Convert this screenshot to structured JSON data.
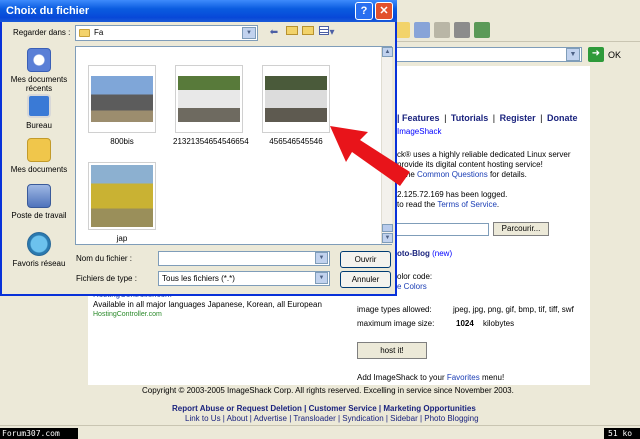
{
  "dialog": {
    "title": "Choix du fichier",
    "help_btn": "?",
    "close_btn": "✕",
    "look_in_label": "Regarder dans :",
    "look_in_value": "Fa",
    "file_name_label": "Nom du fichier :",
    "file_name_value": "",
    "file_type_label": "Fichiers de type :",
    "file_type_value": "Tous les fichiers (*.*)",
    "open_button": "Ouvrir",
    "cancel_button": "Annuler",
    "places": [
      {
        "label": "Mes documents récents",
        "icon": "recent-documents-icon",
        "color": "#5a7fd6"
      },
      {
        "label": "Bureau",
        "icon": "desktop-icon",
        "color": "#3a7ad6"
      },
      {
        "label": "Mes documents",
        "icon": "my-documents-icon",
        "color": "#f0c64b"
      },
      {
        "label": "Poste de travail",
        "icon": "my-computer-icon",
        "color": "#6b8ec8"
      },
      {
        "label": "Favoris réseau",
        "icon": "network-places-icon",
        "color": "#3aa0d6"
      }
    ],
    "files": [
      {
        "name": "800bis"
      },
      {
        "name": "21321354654546654"
      },
      {
        "name": "456546545546"
      },
      {
        "name": "jap"
      }
    ]
  },
  "page": {
    "nav": [
      "| Features",
      "Tutorials",
      "Register",
      "Donate"
    ],
    "imageshack_link": "ImageShack",
    "intro_line1": "ck® uses a highly reliable dedicated Linux server",
    "intro_line2": "provide its digital content hosting service!",
    "intro_line3_pre": "e the ",
    "intro_line3_link": "Common Questions",
    "intro_line3_post": " for details.",
    "ip_line1": "2.125.72.169 has been logged.",
    "ip_line2_pre": "to read the ",
    "ip_line2_link": "Terms of Service",
    "ip_line2_post": ".",
    "browse_button": "Parcourir...",
    "blog_title": "oto-Blog",
    "blog_new": "(new)",
    "color_code": "olor code:",
    "colors_link": "e Colors",
    "image_types_label": "image types allowed:",
    "image_types_value": "jpeg, jpg, png, gif, bmp, tif, tiff, swf",
    "max_size_label": "maximum image size:",
    "max_size_value": "1024",
    "max_size_unit": "kilobytes",
    "host_button": "host it!",
    "add_line_pre": "Add ImageShack to your ",
    "add_line_link": "Favorites",
    "add_line_post": " menu!",
    "languages_link": "HostingController.com",
    "languages_text": "Available in all major languages Japanese, Korean, all European",
    "hosting_link": "HostingController.com",
    "copyright": "Copyright © 2003-2005 ImageShack Corp. All rights reserved. Excelling in service since November 2003.",
    "footer_line1": "Report Abuse or Request Deletion | Customer Service | Marketing Opportunities",
    "footer_line2": "Link to Us | About | Advertise | Transloader | Syndication | Sidebar | Photo Blogging"
  },
  "browser": {
    "go_label": "OK"
  },
  "overlay": {
    "forum_badge": "Forum307.com",
    "size_badge": "51 ko"
  },
  "colors": {
    "titlebar": "#0a5ce0",
    "arrow": "#e8141a",
    "nav_text": "#1a237e"
  }
}
